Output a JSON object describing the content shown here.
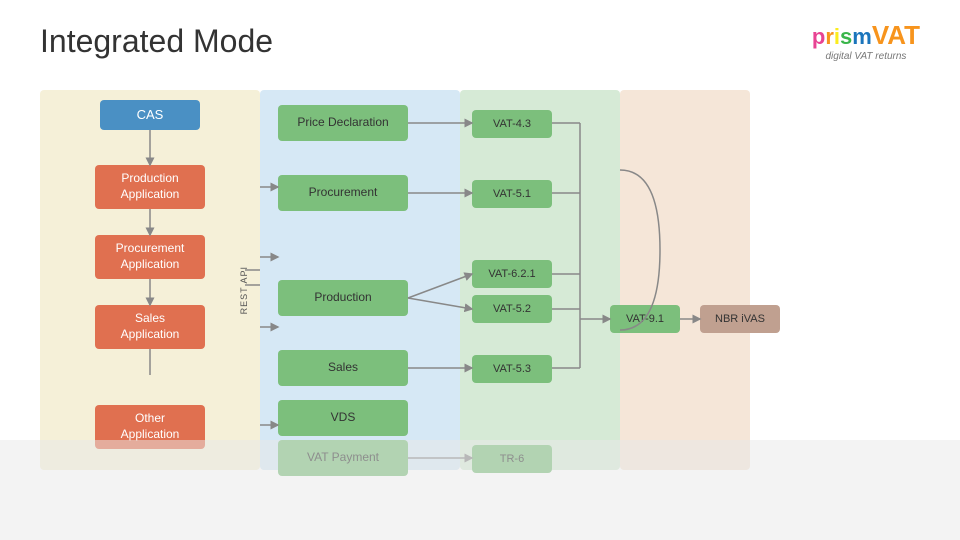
{
  "header": {
    "title": "Integrated Mode"
  },
  "logo": {
    "letters": [
      "p",
      "r",
      "i",
      "s",
      "m"
    ],
    "vat": "VAT",
    "subtitle": "digital VAT returns"
  },
  "diagram": {
    "cas_label": "CAS",
    "rest_api_label": "REST API",
    "app_boxes": [
      {
        "label": "Production\nApplication",
        "id": "prod-app"
      },
      {
        "label": "Procurement\nApplication",
        "id": "proc-app"
      },
      {
        "label": "Sales\nApplication",
        "id": "sales-app"
      },
      {
        "label": "Other\nApplication",
        "id": "other-app"
      }
    ],
    "middle_boxes": [
      {
        "label": "Price Declaration",
        "id": "price-decl"
      },
      {
        "label": "Procurement",
        "id": "procurement"
      },
      {
        "label": "Production",
        "id": "production"
      },
      {
        "label": "Sales",
        "id": "sales"
      },
      {
        "label": "VDS",
        "id": "vds"
      },
      {
        "label": "VAT Payment",
        "id": "vat-payment"
      }
    ],
    "vat_boxes": [
      {
        "label": "VAT-4.3",
        "id": "vat43"
      },
      {
        "label": "VAT-5.1",
        "id": "vat51"
      },
      {
        "label": "VAT-6.2.1",
        "id": "vat621"
      },
      {
        "label": "VAT-5.2",
        "id": "vat52"
      },
      {
        "label": "VAT-5.3",
        "id": "vat53"
      },
      {
        "label": "TR-6",
        "id": "tr6"
      }
    ],
    "vat91_label": "VAT-9.1",
    "nbr_label": "NBR iVAS"
  }
}
